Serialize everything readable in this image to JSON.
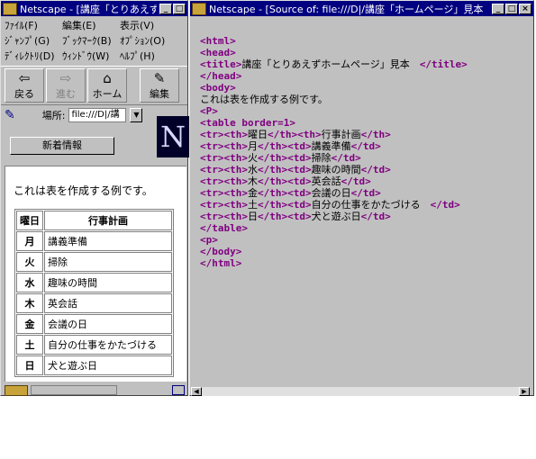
{
  "left_window": {
    "title": "Netscape - [講座「とりあえず",
    "menus": [
      "ﾌｧｲﾙ(F)",
      "編集(E)",
      "表示(V)",
      "ｼﾞｬﾝﾌﾟ(G)",
      "ﾌﾞｯｸﾏｰｸ(B)",
      "ｵﾌﾟｼｮﾝ(O)",
      "ﾃﾞｨﾚｸﾄﾘ(D)",
      "ｳｨﾝﾄﾞｳ(W)",
      "ﾍﾙﾌﾟ(H)"
    ],
    "toolbar": {
      "back": "戻る",
      "forward": "進む",
      "home": "ホーム",
      "edit": "編集"
    },
    "location_label": "場所:",
    "location_value": "file:///D|/講",
    "whats_new": "新着情報",
    "page_text": "これは表を作成する例です。",
    "table": {
      "headers": [
        "曜日",
        "行事計画"
      ],
      "rows": [
        [
          "月",
          "講義準備"
        ],
        [
          "火",
          "掃除"
        ],
        [
          "水",
          "趣味の時間"
        ],
        [
          "木",
          "英会話"
        ],
        [
          "金",
          "会議の日"
        ],
        [
          "土",
          "自分の仕事をかたづける"
        ],
        [
          "日",
          "犬と遊ぶ日"
        ]
      ]
    }
  },
  "right_window": {
    "title": "Netscape - [Source of: file:///D|/講座「ホームページ」見本",
    "source_lines": [
      "<html>",
      "<head>",
      "<title>講座「とりあえずホームページ」見本　</title>",
      "</head>",
      "<body>",
      "これは表を作成する例です。",
      "<P>",
      "<table border=1>",
      "<tr><th>曜日</th><th>行事計画</th>",
      "<tr><th>月</th><td>講義準備</td>",
      "<tr><th>火</th><td>掃除</td>",
      "<tr><th>水</th><td>趣味の時間</td>",
      "<tr><th>木</th><td>英会話</td>",
      "<tr><th>金</th><td>会議の日</td>",
      "<tr><th>土</th><td>自分の仕事をかたづける　</td>",
      "<tr><th>日</th><td>犬と遊ぶ日</td>",
      "</table>",
      "<p>",
      "</body>",
      "</html>"
    ]
  },
  "colors": {
    "titlebar": "#000080",
    "tag": "#800080",
    "chrome": "#c0c0c0"
  }
}
